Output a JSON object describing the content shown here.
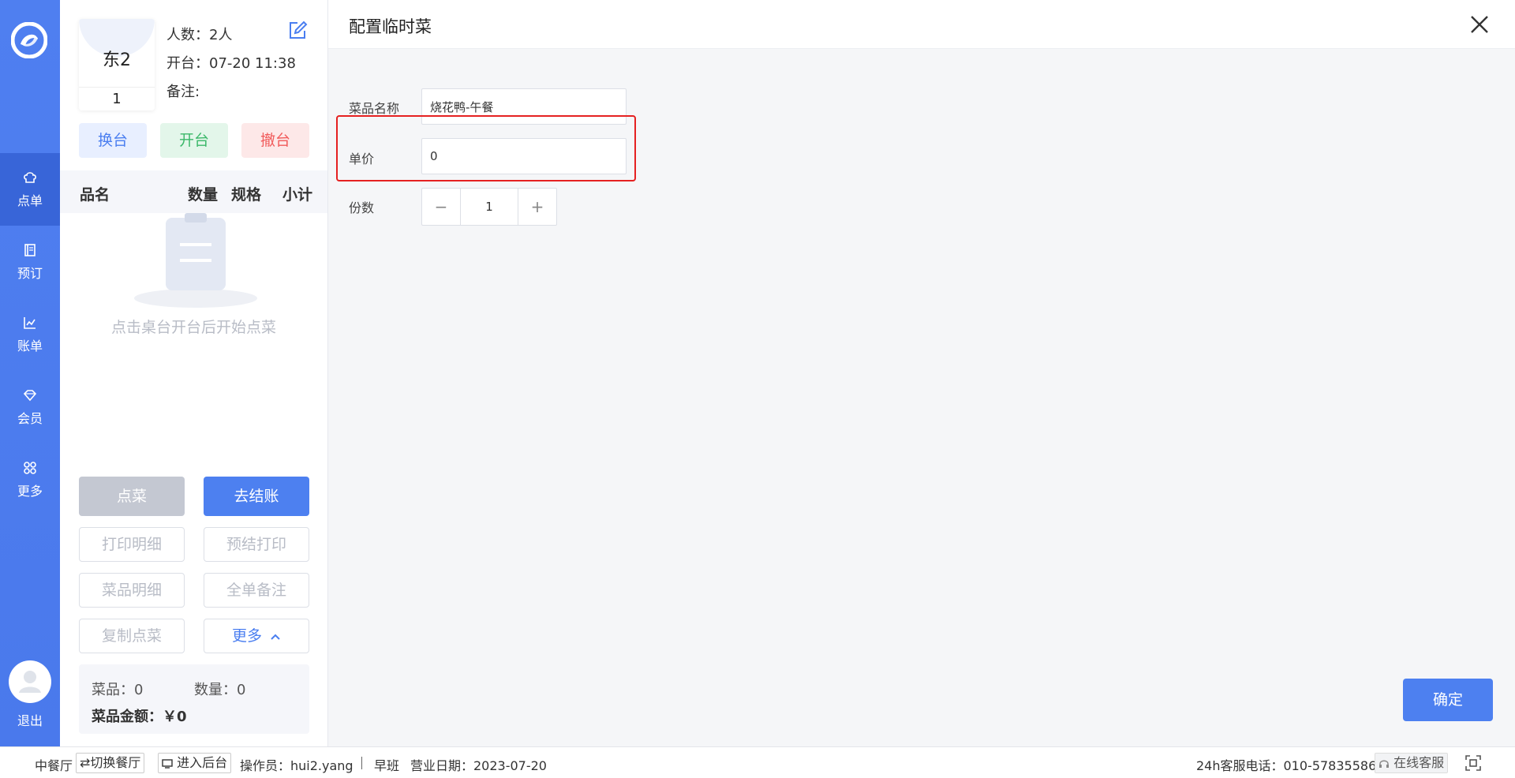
{
  "nav": {
    "items": [
      {
        "label": "点单",
        "icon": "chef-hat-icon"
      },
      {
        "label": "预订",
        "icon": "book-icon"
      },
      {
        "label": "账单",
        "icon": "chart-icon"
      },
      {
        "label": "会员",
        "icon": "diamond-icon"
      },
      {
        "label": "更多",
        "icon": "grid-icon"
      }
    ],
    "logout": "退出"
  },
  "table": {
    "name": "东2",
    "number": "1",
    "guests": "人数：2人",
    "opened": "开台：07-20 11:38",
    "remark": "备注:",
    "swap": "换台",
    "open": "开台",
    "cancel": "撤台"
  },
  "order": {
    "col_name": "品名",
    "col_qty": "数量",
    "col_spec": "规格",
    "col_subtotal": "小计",
    "empty": "点击桌台开台后开始点菜",
    "order_btn": "点菜",
    "checkout_btn": "去结账",
    "print_detail": "打印明细",
    "pre_print": "预结打印",
    "dish_detail": "菜品明细",
    "order_remark": "全单备注",
    "copy_order": "复制点菜",
    "more": "更多",
    "dishes": "菜品：0",
    "quantity": "数量：0",
    "amount": "菜品金额：￥0"
  },
  "config": {
    "title": "配置临时菜",
    "name_label": "菜品名称",
    "name_value": "烧花鸭-午餐",
    "price_label": "单价",
    "price_value": "0",
    "portion_label": "份数",
    "portion_value": "1",
    "minus": "−",
    "plus": "+",
    "confirm": "确定"
  },
  "footer": {
    "restaurant": "中餐厅",
    "switch": "⇄切换餐厅",
    "backend": "进入后台",
    "operator": "操作员：hui2.yang",
    "shift": "早班",
    "biz_date": "营业日期：2023-07-20",
    "hotline": "24h客服电话：010-57835586",
    "online_service": "在线客服"
  },
  "colors": {
    "primary": "#4d80f0",
    "nav": "#4f7ff0",
    "nav_active": "#3865d8",
    "highlight": "#e52121"
  }
}
